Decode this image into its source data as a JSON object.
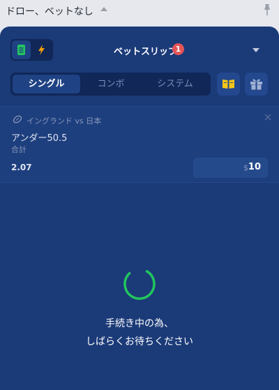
{
  "header": {
    "title": "ドロー、ベットなし"
  },
  "betslip": {
    "title": "ベットスリップ",
    "count": "1",
    "tabs": [
      "シングル",
      "コンボ",
      "システム"
    ]
  },
  "bet": {
    "sport_icon": "football-icon",
    "match": "イングランド vs 日本",
    "selection": "アンダー50.5",
    "market": "合計",
    "odds": "2.07",
    "currency": "$",
    "stake": "10"
  },
  "loading": {
    "line1": "手続き中の為、",
    "line2": "しばらくお待ちください"
  },
  "colors": {
    "panel": "#1b3a78",
    "badge": "#e45558",
    "spinner": "#22c55e",
    "lightning": "#f59e0b",
    "book": "#f5c518"
  }
}
